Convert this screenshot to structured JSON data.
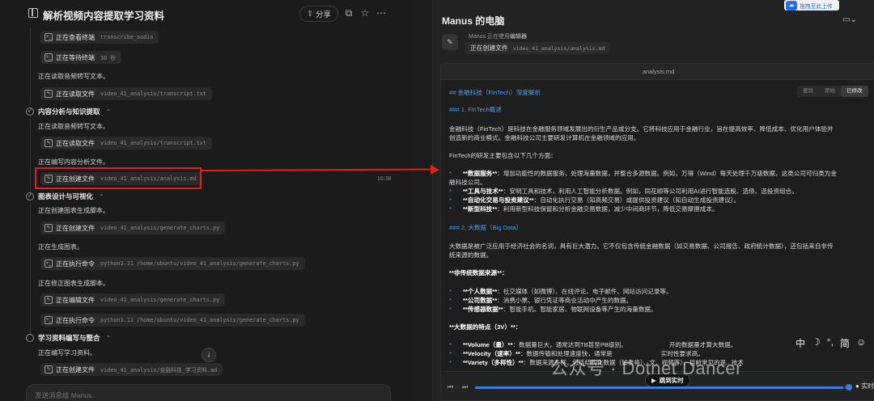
{
  "left": {
    "title": "解析视频内容提取学习资料",
    "share_label": "分享",
    "timestamp": "16:38",
    "input_placeholder": "发送消息给 Manus"
  },
  "timeline": {
    "steps": [
      {
        "label": "正在查看终端",
        "arg": "transcribe_audio"
      },
      {
        "label": "正在等待终端",
        "arg": "30 秒"
      },
      {
        "label": "正在读取文件",
        "arg": "video_41_analysis/transcript.txt"
      },
      {
        "label": "正在读取文件",
        "arg": "video_41_analysis/transcript.txt"
      },
      {
        "label": "正在创建文件",
        "arg": "video_41_analysis/analysis.md"
      },
      {
        "label": "正在创建文件",
        "arg": "video_41_analysis/generate_charts.py"
      },
      {
        "label": "正在执行命令",
        "arg": "python3.11 /home/ubuntu/video_41_analysis/generate_charts.py"
      },
      {
        "label": "正在编辑文件",
        "arg": "video_41_analysis/generate_charts.py"
      },
      {
        "label": "正在执行命令",
        "arg": "python3.11 /home/ubuntu/video_41_analysis/generate_charts.py"
      },
      {
        "label": "正在创建文件",
        "arg": "video_41_analysis/金融科技_学习资料.md"
      }
    ],
    "texts": [
      "正在读取音频转写文本。",
      "正在读取音频转写文本。",
      "正在编写内容分析文件。",
      "正在创建图表生成脚本。",
      "正在生成图表。",
      "正在修正图表生成脚本。",
      "正在编写学习资料。"
    ],
    "sections": [
      {
        "title": "内容分析与知识提取"
      },
      {
        "title": "图表设计与可视化"
      },
      {
        "title": "学习资料编写与整合"
      }
    ]
  },
  "right": {
    "title": "Manus 的电脑",
    "using_prefix": "Manus 正在使用",
    "using_tool": "编辑器",
    "creating_label": "正在创建文件",
    "creating_arg": "video_41_analysis/analysis.md",
    "file_name": "analysis.md",
    "view_modes": [
      "差异",
      "原始",
      "已修改"
    ],
    "upload_badge": "拖拽至此上传",
    "jump_live": "跳到实时",
    "live_label": "实时",
    "progress": 0.99
  },
  "markdown": {
    "h2": "## 金融科技（FinTech）深度解析",
    "h3_1": "### 1. FinTech概述",
    "p1a": "金融科技（FinTech）是科技在金融服务领域发展出的衍生产品或分支。它将科技应用于金融行业，旨在提高效率、降低成本、优化用户体验并",
    "p1b": "创造新的商业模式。金融科技公司主要研发计算机在金融领域的应用。",
    "p2": "FinTech的研发主要包含以下几个方面：",
    "b1_bold": "**数据服务**",
    "b1_text": "：增加功能性的数据服务，处理海量数据，并整合多源数据。例如，万得（Wind）每天处理千万级数据，这类公司可归类为金",
    "b1_cont": "融科技公司。",
    "b2_bold": "**工具与技术**",
    "b2_text": "：安明工具和技术，利用人工智能分析数据。例如，同花顺等公司利用AI进行智能选股、选债、选投资组合。",
    "b3_bold": "**自动化交易与投资建议**",
    "b3_text": "：自动化执行交易（知高频交易）或提供投资建议（知自动生成投资建议）。",
    "b4_bold": "**新型科技**",
    "b4_text": "：利用新型科技保留和分析金融交易数据，减少中间商环节，降低交易摩擦成本。",
    "h3_2": "### 2. 大数据（Big Data）",
    "p3a": "大数据是被广泛应用于经济社会的名词，具有巨大潜力。它不仅包含传统金融数据（如交易数据、公司报告、政府统计数据），还包括来自非传",
    "p3b": "统来源的数据。",
    "p4": "**非传统数据来源**：",
    "c1_bold": "**个人数据**",
    "c1_text": "：社交媒体（如微博）、在线评论、电子邮件、网站访问记录等。",
    "c2_bold": "**公司数据**",
    "c2_text": "：消费小票、银行凭证等商业活动中产生的数据。",
    "c3_bold": "**传感器数据**",
    "c3_text": "：智能手机、智能家居、物联网设备等产生的海量数据。",
    "p5": "**大数据的特点（3V）**：",
    "d1_bold": "**Volume（量）**",
    "d1_text": "：数据量巨大，通常达到TB甚至PB级别。",
    "d1_tail": "开的数据量才算大数据。",
    "d2_bold": "**Velocity（速率）**",
    "d2_text": "：数据传输和处理速度快，通常是",
    "d2_tail": "实时性要求高。",
    "d3_bold": "**Variety（多样性）**",
    "d3_text": "：数据来源多样，包括结构化数据（如表格）、",
    "d3_tail": "文、视频等），目前常见的是...技术"
  },
  "watermark": "公众号 · Dotnet Dancer",
  "ime": [
    "中",
    "☽",
    "°,",
    "简",
    "☺"
  ]
}
